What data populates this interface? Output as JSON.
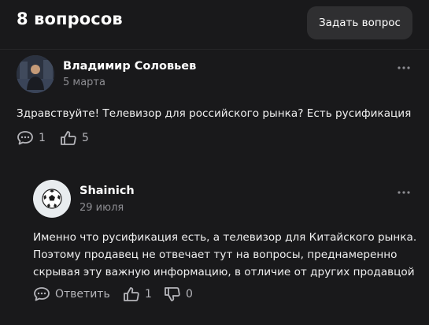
{
  "header": {
    "title": "8 вопросов",
    "ask_button": "Задать вопрос"
  },
  "question": {
    "author": "Владимир Соловьев",
    "date": "5 марта",
    "text": "Здравствуйте! Телевизор для российского рынка? Есть русификация",
    "comments_count": "1",
    "likes_count": "5",
    "more_icon": "more-dots-icon"
  },
  "answer": {
    "author": "Shainich",
    "date": "29 июля",
    "text_lines": [
      "Именно что русификация есть, а телевизор для Китайского рынка.",
      "Поэтому продавец не отвечает тут на вопросы, преднамеренно",
      "скрывая эту важную информацию, в отличие от других продавцой"
    ],
    "reply_label": "Ответить",
    "likes_count": "1",
    "dislikes_count": "0"
  }
}
